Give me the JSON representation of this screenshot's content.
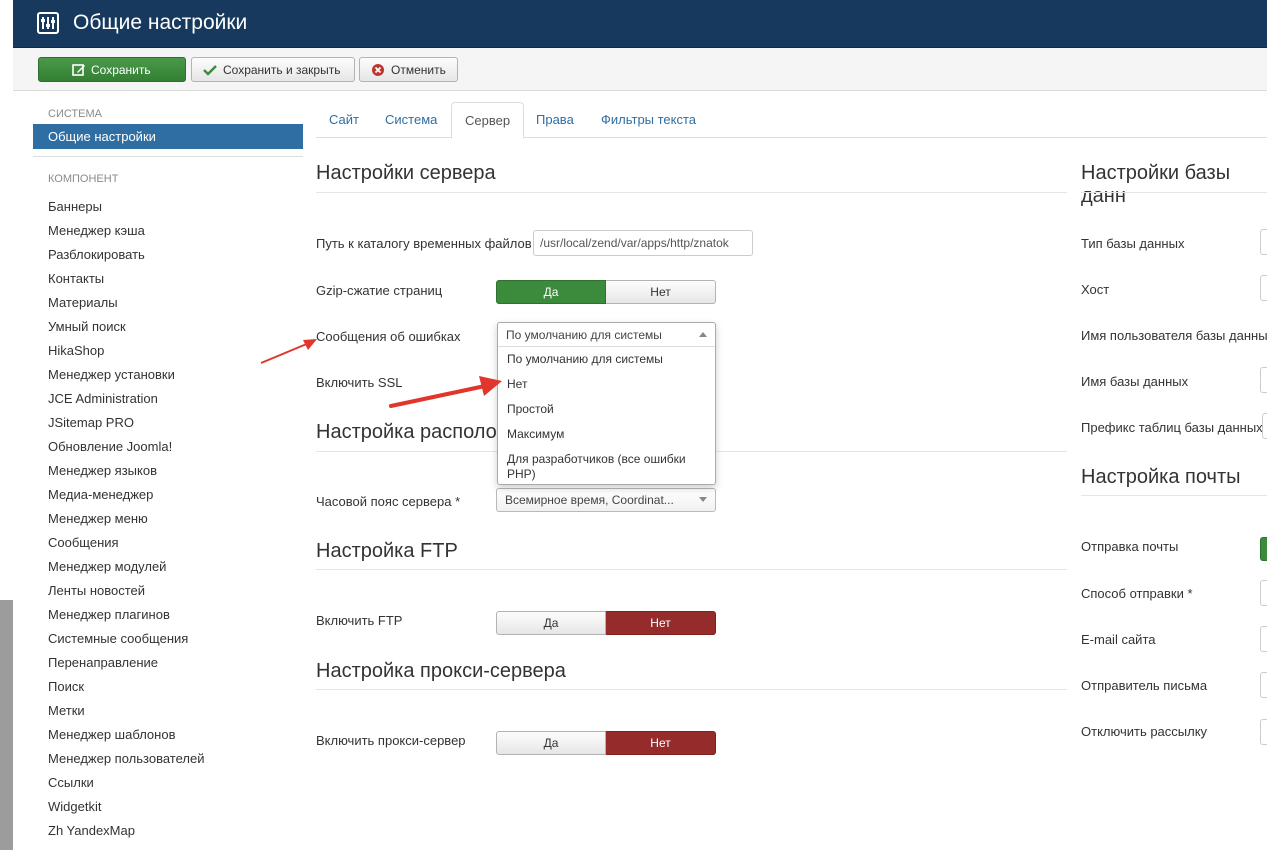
{
  "header": {
    "title": "Общие настройки",
    "icon": "sliders-icon"
  },
  "toolbar": {
    "save_label": "Сохранить",
    "save_close_label": "Сохранить и закрыть",
    "cancel_label": "Отменить"
  },
  "sidebar": {
    "system_heading": "СИСТЕМА",
    "active_item": "Общие настройки",
    "component_heading": "КОМПОНЕНТ",
    "items": [
      "Баннеры",
      "Менеджер кэша",
      "Разблокировать",
      "Контакты",
      "Материалы",
      "Умный поиск",
      "HikaShop",
      "Менеджер установки",
      "JCE Administration",
      "JSitemap PRO",
      "Обновление Joomla!",
      "Менеджер языков",
      "Медиа-менеджер",
      "Менеджер меню",
      "Сообщения",
      "Менеджер модулей",
      "Ленты новостей",
      "Менеджер плагинов",
      "Системные сообщения",
      "Перенаправление",
      "Поиск",
      "Метки",
      "Менеджер шаблонов",
      "Менеджер пользователей",
      "Ссылки",
      "Widgetkit",
      "Zh YandexMap"
    ]
  },
  "tabs": [
    "Сайт",
    "Система",
    "Сервер",
    "Права",
    "Фильтры текста"
  ],
  "active_tab": "Сервер",
  "server": {
    "title": "Настройки сервера",
    "tmp_path_label": "Путь к каталогу временных файлов",
    "tmp_path_value": "/usr/local/zend/var/apps/http/znatok",
    "gzip_label": "Gzip-сжатие страниц",
    "gzip_yes": "Да",
    "gzip_no": "Нет",
    "errors_label": "Сообщения об ошибках",
    "errors_selected": "По умолчанию для системы",
    "errors_options": [
      "По умолчанию для системы",
      "Нет",
      "Простой",
      "Максимум",
      "Для разработчиков (все ошибки PHP)"
    ],
    "ssl_label": "Включить SSL"
  },
  "location": {
    "title": "Настройка располож",
    "timezone_label": "Часовой пояс сервера *",
    "timezone_value": "Всемирное время, Coordinat..."
  },
  "ftp": {
    "title": "Настройка FTP",
    "enable_label": "Включить FTP",
    "yes": "Да",
    "no": "Нет"
  },
  "proxy": {
    "title": "Настройка прокси-сервера",
    "enable_label": "Включить прокси-сервер",
    "yes": "Да",
    "no": "Нет"
  },
  "database": {
    "title": "Настройки базы данн",
    "type_label": "Тип базы данных",
    "host_label": "Хост",
    "user_label": "Имя пользователя базы данных",
    "name_label": "Имя базы данных",
    "prefix_label": "Префикс таблиц базы данных"
  },
  "mail": {
    "title": "Настройка почты",
    "send_label": "Отправка почты",
    "method_label": "Способ отправки *",
    "site_email_label": "E-mail сайта",
    "from_label": "Отправитель письма",
    "disable_label": "Отключить рассылку"
  },
  "colors": {
    "header_bg": "#17395e",
    "accent_blue": "#2f6ea3",
    "green": "#3c8b3c",
    "red": "#962b2b",
    "annotation_arrow": "#e0362c"
  }
}
